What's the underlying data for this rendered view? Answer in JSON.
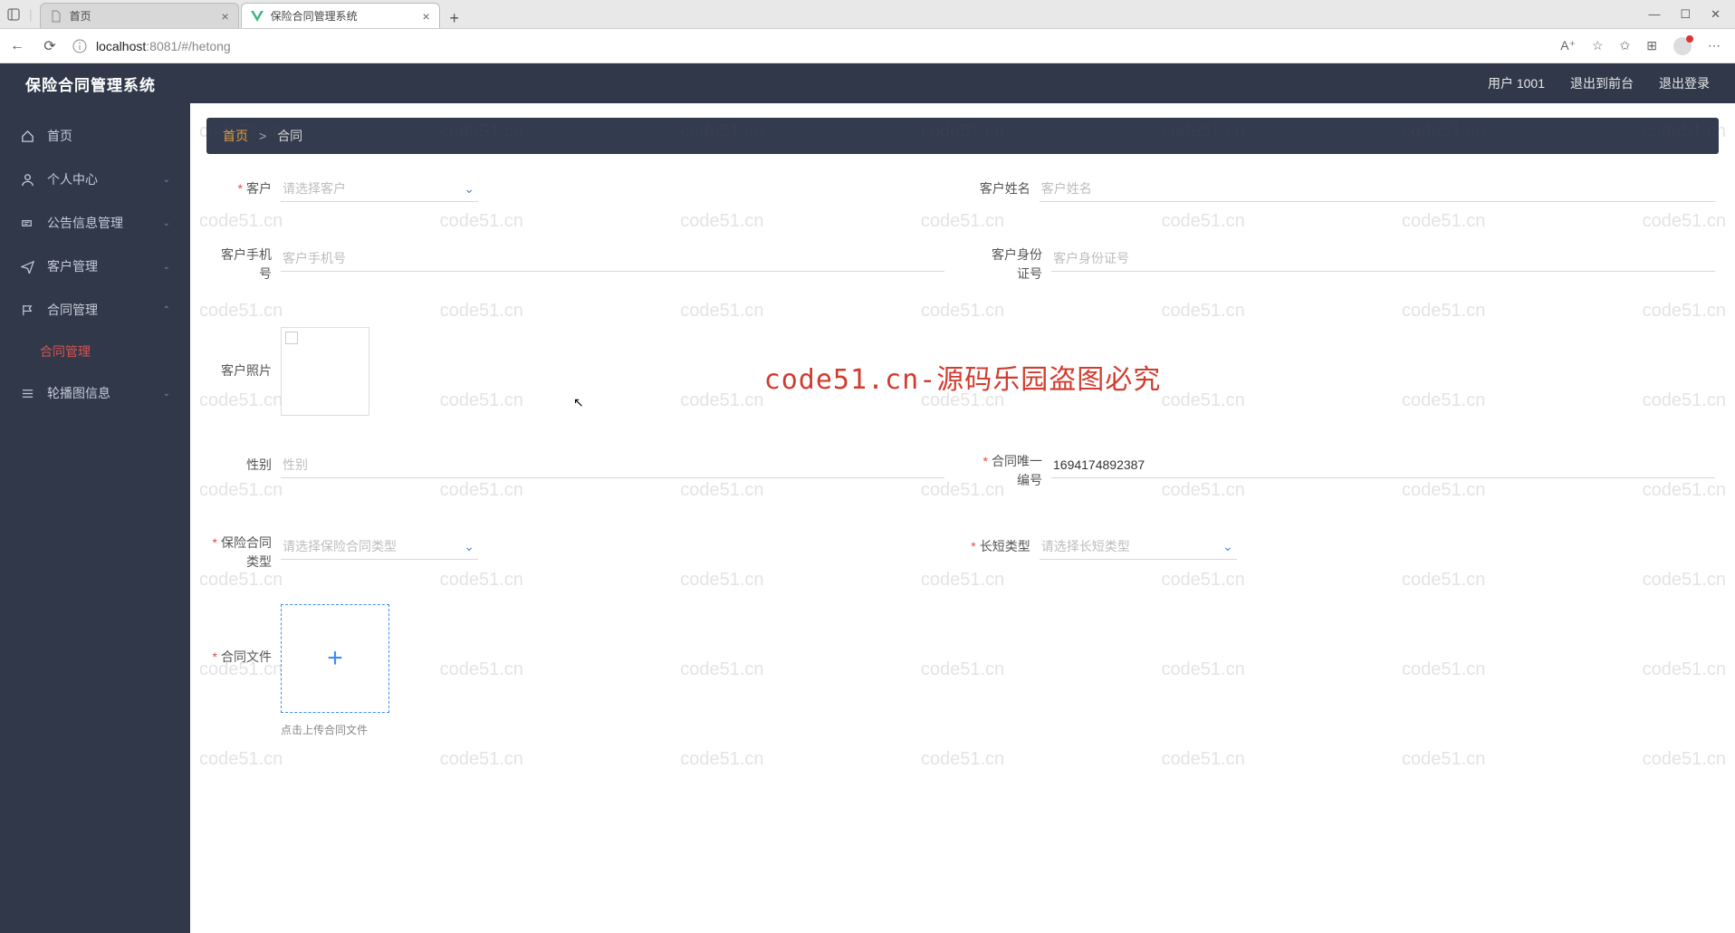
{
  "browser": {
    "tabs": [
      {
        "title": "首页",
        "icon": "page"
      },
      {
        "title": "保险合同管理系统",
        "icon": "vue"
      }
    ],
    "url_host": "localhost",
    "url_port": ":8081",
    "url_path": "/#/hetong",
    "win": {
      "min": "—",
      "max": "☐",
      "close": "✕"
    }
  },
  "app": {
    "title": "保险合同管理系统",
    "user_label": "用户 1001",
    "back_front": "退出到前台",
    "logout": "退出登录"
  },
  "sidebar": {
    "items": [
      {
        "icon": "home",
        "label": "首页",
        "arrow": false
      },
      {
        "icon": "user",
        "label": "个人中心",
        "arrow": true
      },
      {
        "icon": "bullhorn",
        "label": "公告信息管理",
        "arrow": true
      },
      {
        "icon": "send",
        "label": "客户管理",
        "arrow": true
      },
      {
        "icon": "flag",
        "label": "合同管理",
        "arrow": true,
        "expanded": true,
        "sub": "合同管理"
      },
      {
        "icon": "sliders",
        "label": "轮播图信息",
        "arrow": true
      }
    ]
  },
  "breadcrumb": {
    "home": "首页",
    "sep": ">",
    "current": "合同"
  },
  "form": {
    "customer": {
      "label": "客户",
      "placeholder": "请选择客户"
    },
    "customer_name": {
      "label": "客户姓名",
      "placeholder": "客户姓名"
    },
    "customer_phone": {
      "label": "客户手机号",
      "placeholder": "客户手机号"
    },
    "customer_idnum": {
      "label": "客户身份证号",
      "placeholder": "客户身份证号"
    },
    "customer_photo": {
      "label": "客户照片"
    },
    "gender": {
      "label": "性别",
      "placeholder": "性别"
    },
    "contract_uid": {
      "label": "合同唯一编号",
      "value": "1694174892387"
    },
    "insurance_type": {
      "label": "保险合同类型",
      "placeholder": "请选择保险合同类型"
    },
    "term_type": {
      "label": "长短类型",
      "placeholder": "请选择长短类型"
    },
    "contract_file": {
      "label": "合同文件",
      "hint": "点击上传合同文件"
    }
  },
  "watermark": {
    "repeat": "code51.cn",
    "center": "code51.cn-源码乐园盗图必究"
  }
}
